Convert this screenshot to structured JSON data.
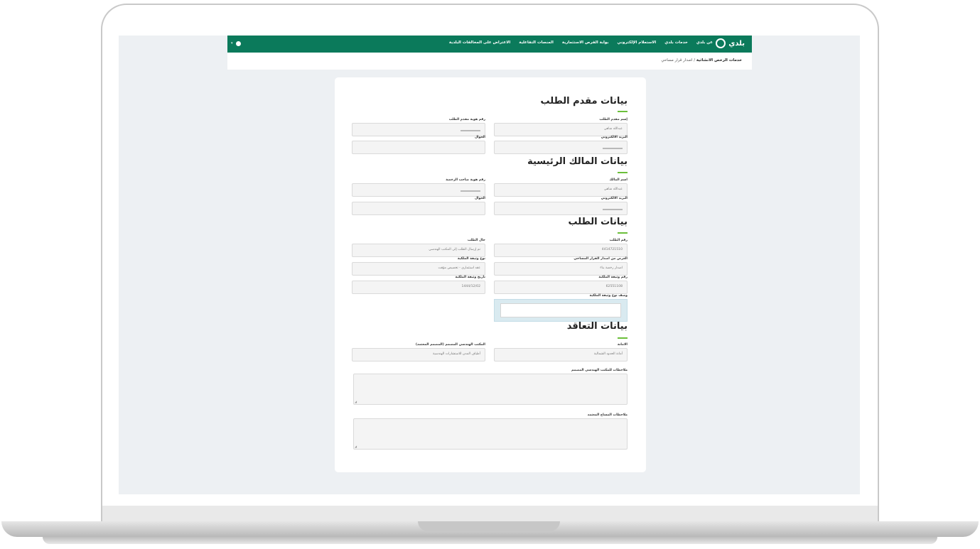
{
  "navbar": {
    "logo_text": "بلدي",
    "items": [
      "عن بلدي",
      "خدمات بلدي",
      "الاستعلام الإلكتروني",
      "بوابة الفرص الاستثمارية",
      "المنصات التفاعلية",
      "الاعتراض على المخالفات البلدية"
    ]
  },
  "breadcrumb": {
    "root": "خدمات الرخص الانشائية",
    "separator": "/",
    "current": "اصدار قرار مساحي"
  },
  "sections": {
    "applicant": {
      "title": "بيانات مقدم الطلب",
      "name_label": "إسم مقدم الطلب",
      "name_value": "عبدالله شاهي",
      "id_label": "رقم هوية مقدم الطلب",
      "email_label": "البريد الالكتروني",
      "mobile_label": "الجوال"
    },
    "owner": {
      "title": "بيانات المالك الرئيسية",
      "name_label": "اسم المالك",
      "name_value": "عبدالله شاهي",
      "id_label": "رقم هوية صاحب الرخصة",
      "email_label": "البريد الالكتروني",
      "mobile_label": "الجوال"
    },
    "request": {
      "title": "بيانات الطلب",
      "number_label": "رقم الطلب",
      "number_value": "4414721510",
      "status_label": "حال الطلب",
      "status_value": "تم إرسال الطلب إلى المكتب الهندسي",
      "purpose_label": "الغرض من اصدار القرار المساحي",
      "purpose_value": "اصدار رخصة بناء",
      "doc_type_label": "نوع وثيقة الملكية",
      "doc_type_value": "عقد استثماري - تخصيص مؤقت",
      "doc_number_label": "رقم وثيقة الملكية",
      "doc_number_value": "62551108",
      "doc_date_label": "تاريخ وثيقة الملكية",
      "doc_date_value": "1444/12/02",
      "doc_desc_label": "وصف نوع وثيقة الملكية"
    },
    "contract": {
      "title": "بيانات التعاقد",
      "region_label": "الامانة",
      "region_value": "أمانة الحدود الشمالية",
      "office_label": "المكتب الهندسي المصمم (المصمم المعتمد)",
      "office_value": "أطياف المدن للاستشارات الهندسية",
      "notes_designer_label": "ملاحظات للمكتب الهندسي المصمم",
      "notes_surveyor_label": "ملاحظات المساح المعتمد"
    }
  },
  "colors": {
    "primary": "#0b7a5b",
    "accent": "#6bbf3a"
  }
}
